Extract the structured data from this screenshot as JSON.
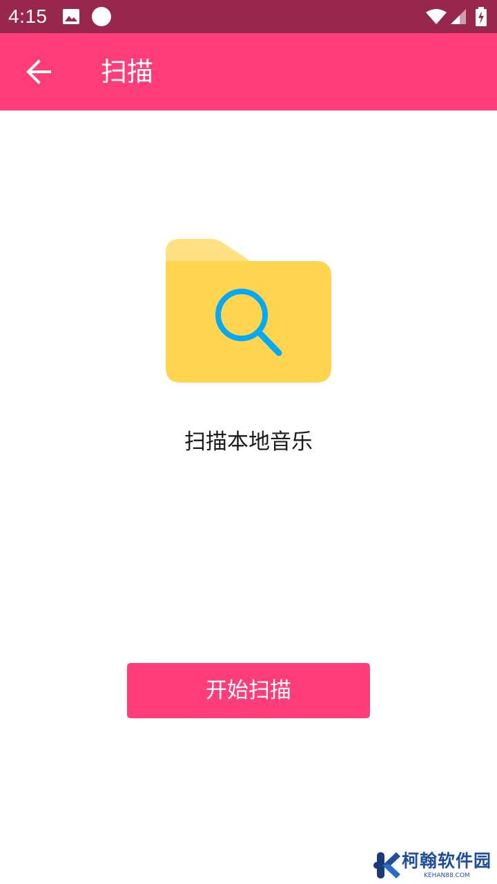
{
  "status_bar": {
    "time": "4:15",
    "background": "#98264d",
    "icons": [
      "image-icon",
      "circle-indicator-icon",
      "wifi-icon",
      "cell-signal-icon",
      "battery-charging-icon"
    ]
  },
  "app_bar": {
    "title": "扫描",
    "background": "#ff3d7a",
    "back_icon": "arrow-left-icon"
  },
  "main": {
    "illustration_icon": "folder-search-icon",
    "caption": "扫描本地音乐",
    "start_button_label": "开始扫描",
    "accent": "#ff3d7a",
    "folder_color": "#ffd54f",
    "magnifier_color": "#03a9f4"
  },
  "watermark": {
    "name": "柯翰软件园",
    "domain": "KEHAN88.COM",
    "color": "#1f4e9c"
  }
}
